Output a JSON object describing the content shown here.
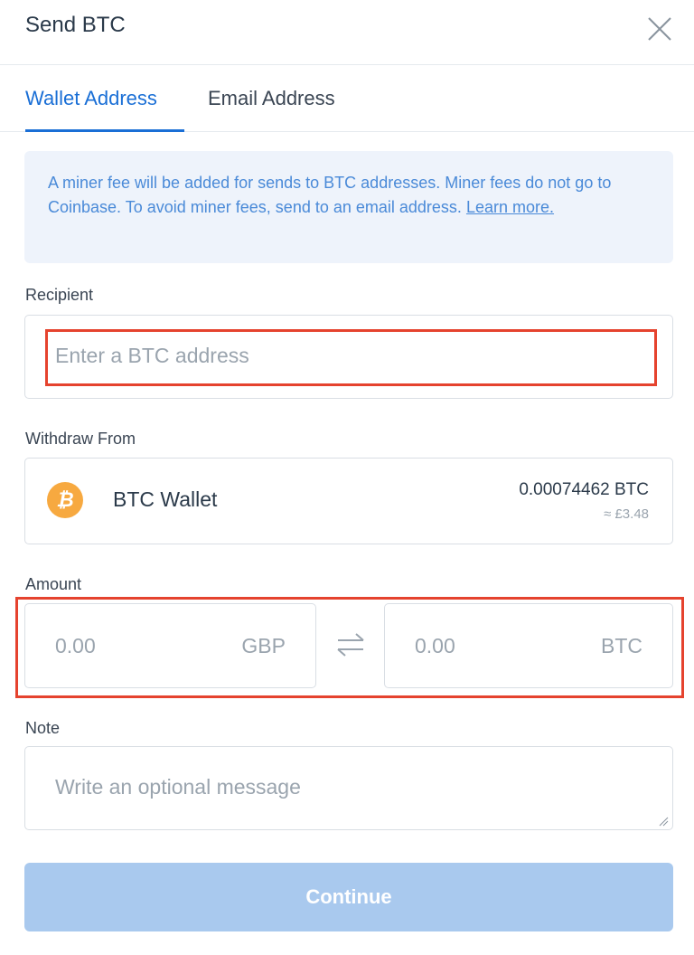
{
  "dialog": {
    "title": "Send BTC",
    "close_icon": "close-icon"
  },
  "tabs": [
    {
      "label": "Wallet Address",
      "active": true
    },
    {
      "label": "Email Address",
      "active": false
    }
  ],
  "notice": {
    "text": "A miner fee will be added for sends to BTC addresses. Miner fees do not go to Coinbase. To avoid miner fees, send to an email address.",
    "link": "Learn more."
  },
  "recipient": {
    "label": "Recipient",
    "placeholder": "Enter a BTC address"
  },
  "withdraw": {
    "label": "Withdraw From",
    "wallet_icon": "bitcoin-icon",
    "wallet_icon_glyph": "₿",
    "wallet_name": "BTC Wallet",
    "balance": "0.00074462 BTC",
    "fiat": "≈ £3.48"
  },
  "amount": {
    "label": "Amount",
    "fiat_value": "0.00",
    "fiat_currency": "GBP",
    "swap_icon": "swap-arrows-icon",
    "crypto_value": "0.00",
    "crypto_currency": "BTC"
  },
  "note": {
    "label": "Note",
    "placeholder": "Write an optional message"
  },
  "continue_label": "Continue",
  "colors": {
    "accent": "#1a6fd6",
    "notice_bg": "#eef3fb",
    "highlight": "#e5432e",
    "button_disabled": "#a9c9ee",
    "bitcoin": "#f7a940"
  }
}
